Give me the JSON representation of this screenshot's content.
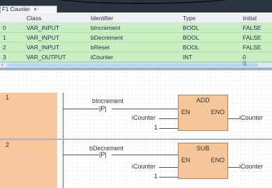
{
  "window": {
    "tab_label": "Counter",
    "tab_prefix": "F1",
    "tab_close": "×"
  },
  "variables": {
    "headers": [
      "",
      "Class",
      "Identifier",
      "Type",
      "Initial"
    ],
    "rows": [
      {
        "index": "0",
        "class": "VAR_INPUT",
        "identifier": "bIncrement",
        "type": "BOOL",
        "initial": "FALSE"
      },
      {
        "index": "1",
        "class": "VAR_INPUT",
        "identifier": "bDecrement",
        "type": "BOOL",
        "initial": "FALSE"
      },
      {
        "index": "2",
        "class": "VAR_INPUT",
        "identifier": "bReset",
        "type": "BOOL",
        "initial": "FALSE"
      },
      {
        "index": "3",
        "class": "VAR_OUTPUT",
        "identifier": "iCounter",
        "type": "INT",
        "initial": "0"
      }
    ]
  },
  "networks": [
    {
      "number": "1",
      "contact_var": "bIncrement",
      "contact_symbol": "P",
      "block_name": "ADD",
      "en": "EN",
      "eno": "ENO",
      "input1": "iCounter",
      "input2": "1",
      "output": "iCounter"
    },
    {
      "number": "2",
      "contact_var": "bDecrement",
      "contact_symbol": "P",
      "block_name": "SUB",
      "en": "EN",
      "eno": "ENO",
      "input1": "iCounter",
      "input2": "1",
      "output": "iCounter"
    }
  ],
  "colors": {
    "variable_row_bg": "#c9eec1",
    "block_bg": "#f6c69a",
    "network_number_bg": "#f9c79d"
  }
}
